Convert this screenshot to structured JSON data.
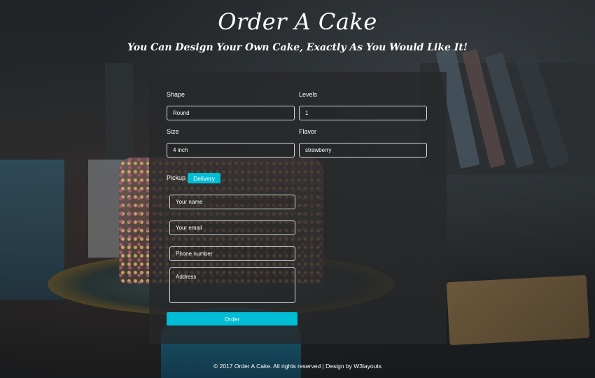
{
  "header": {
    "title": "Order A Cake",
    "subtitle": "You Can Design Your Own Cake, Exactly As You Would Like It!"
  },
  "form": {
    "shape": {
      "label": "Shape",
      "value": "Round"
    },
    "levels": {
      "label": "Levels",
      "value": "1"
    },
    "size": {
      "label": "Size",
      "value": "4 inch"
    },
    "flavor": {
      "label": "Flavor",
      "value": "strawberry"
    },
    "pickup_label": "Pickup",
    "delivery_label": "Delivery",
    "name_placeholder": "Your name",
    "email_placeholder": "Your email",
    "phone_placeholder": "Phone number",
    "address_placeholder": "Address",
    "order_label": "Order"
  },
  "footer": {
    "text": "© 2017 Order A Cake. All rights reserved | Design by W3layouts"
  },
  "colors": {
    "accent": "#00bcd4",
    "panel": "#262829"
  }
}
